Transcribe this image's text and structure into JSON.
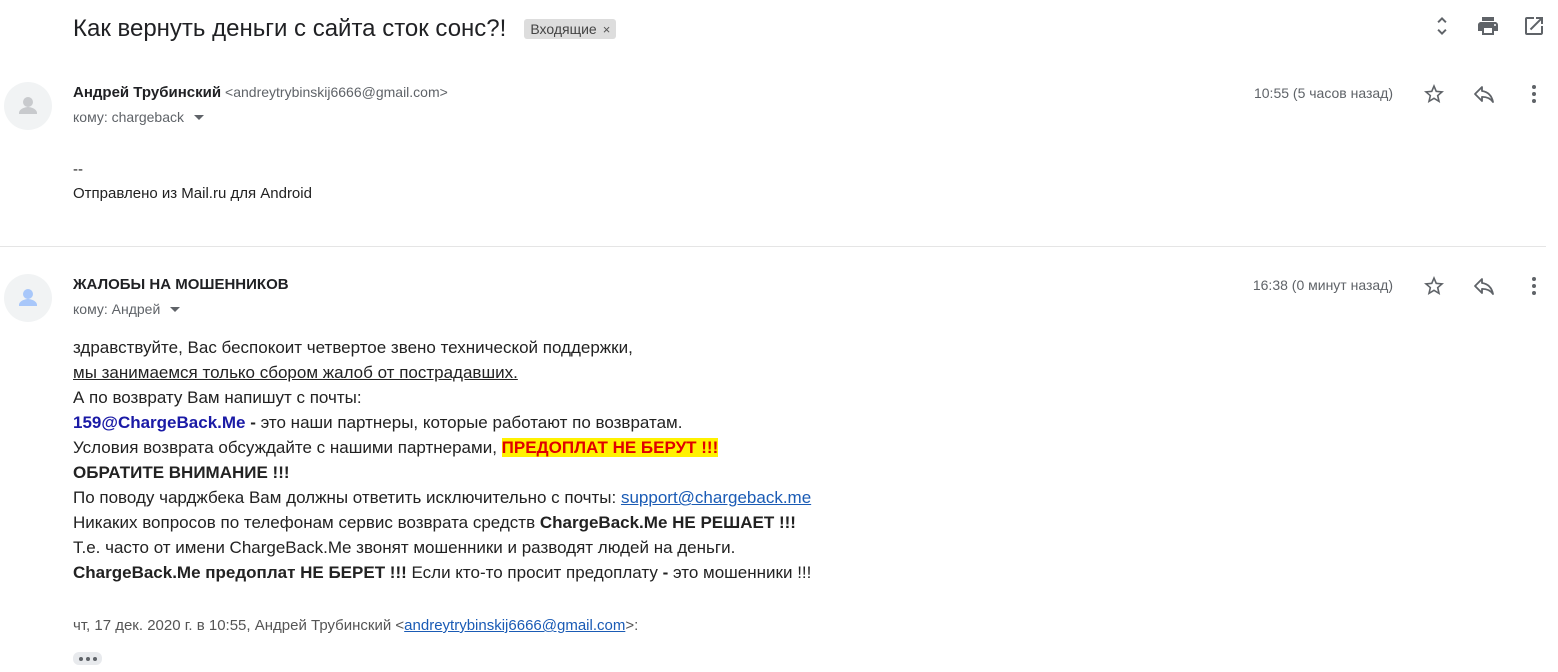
{
  "thread": {
    "subject": "Как вернуть деньги с сайта сток сонс?!",
    "label": "Входящие",
    "label_remove": "×"
  },
  "top_icons": [
    "expand-collapse-icon",
    "print-icon",
    "open-in-new-window-icon"
  ],
  "messages": [
    {
      "sender_name": "Андрей Трубинский",
      "sender_email": "<andreytrybinskij6666@gmail.com>",
      "to": "кому: chargeback",
      "time": "10:55 (5 часов назад)",
      "body_lines": [
        "--",
        "Отправлено из Mail.ru для Android"
      ]
    },
    {
      "sender_name": "ЖАЛОБЫ НА МОШЕННИКОВ",
      "to": "кому: Андрей",
      "time": "16:38 (0 минут назад)",
      "body": {
        "l1": "здравствуйте, Вас беспокоит четвертое звено технической поддержки,",
        "l2": "мы занимаемся только сбором жалоб от пострадавших.",
        "l3": "А по возврату Вам напишут с почты:",
        "l4_email": "159@ChargeBack.Me",
        "l4_dash": " - ",
        "l4_rest": "это наши партнеры, которые работают по возвратам.",
        "l5_text": "Условия возврата обсуждайте с нашими партнерами, ",
        "l5_warn": "ПРЕДОПЛАТ НЕ БЕРУТ !!!",
        "l6": "ОБРАТИТЕ ВНИМАНИЕ !!!",
        "l7_text": "По поводу чарджбека Вам должны ответить исключительно с почты: ",
        "l7_link": "support@chargeback.me",
        "l8_text": "Никаких вопросов по телефонам сервис возврата средств ",
        "l8_bold": "ChargeBack.Me НЕ РЕШАЕТ !!!",
        "l9": "Т.е. часто от имени ChargeBack.Me звонят мошенники и разводят людей на деньги.",
        "l10_bold": "ChargeBack.Me предоплат НЕ БЕРЕТ !!!",
        "l10_text": " Если кто-то просит предоплату ",
        "l10_dash": "-",
        "l10_end": " это мошенники !!!"
      },
      "quote_prefix": "чт, 17 дек. 2020 г. в 10:55, Андрей Трубинский <",
      "quote_email": "andreytrybinskij6666@gmail.com",
      "quote_suffix": ">:"
    }
  ],
  "message_icons": [
    "star-icon",
    "reply-icon",
    "more-vert-icon"
  ]
}
